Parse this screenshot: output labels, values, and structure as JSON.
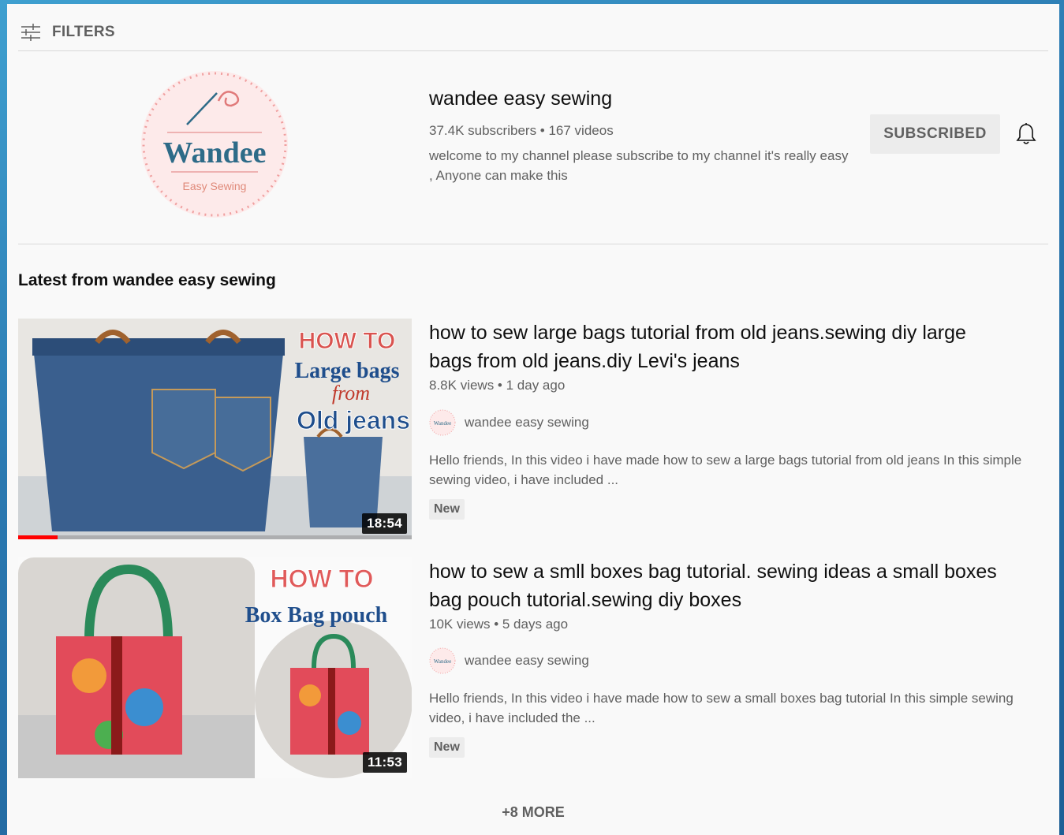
{
  "filters": {
    "label": "FILTERS",
    "icon": "sliders-icon"
  },
  "channel": {
    "avatar_text": "Wandee",
    "avatar_sub": "Easy Sewing",
    "name": "wandee easy sewing",
    "stats": "37.4K subscribers • 167 videos",
    "description": "welcome to my channel please subscribe to my channel it's really easy , Anyone can make this",
    "subscribe_label": "SUBSCRIBED",
    "bell_icon": "bell-icon"
  },
  "section": {
    "title": "Latest from wandee easy sewing"
  },
  "videos": [
    {
      "title": "how to sew large bags tutorial from old jeans.sewing diy large bags from old jeans.diy Levi's jeans",
      "meta": "8.8K views • 1 day ago",
      "channel": "wandee easy sewing",
      "description": "Hello friends, In this video i have made how to sew a large bags tutorial from old jeans In this simple sewing video, i have included ...",
      "badge": "New",
      "duration": "18:54",
      "watched_fraction": 0.1,
      "thumb": {
        "line1": "HOW TO",
        "line2": "Large bags",
        "line3": "from",
        "line4": "Old jeans"
      }
    },
    {
      "title": "how to sew a smll boxes bag tutorial. sewing ideas a small boxes bag pouch tutorial.sewing diy boxes",
      "meta": "10K views • 5 days ago",
      "channel": "wandee easy sewing",
      "description": "Hello friends, In this video i have made how to sew a small boxes bag tutorial In this simple sewing video, i have included the ...",
      "badge": "New",
      "duration": "11:53",
      "thumb": {
        "line1": "HOW TO",
        "line2": "Box Bag pouch"
      }
    }
  ],
  "more": {
    "label": "+8 MORE"
  },
  "colors": {
    "accent_red": "#ff0000",
    "text_primary": "#0f0f0f",
    "text_secondary": "#606060",
    "thumb_title_red": "#d9534f",
    "thumb_title_blue": "#1f4e8c"
  }
}
